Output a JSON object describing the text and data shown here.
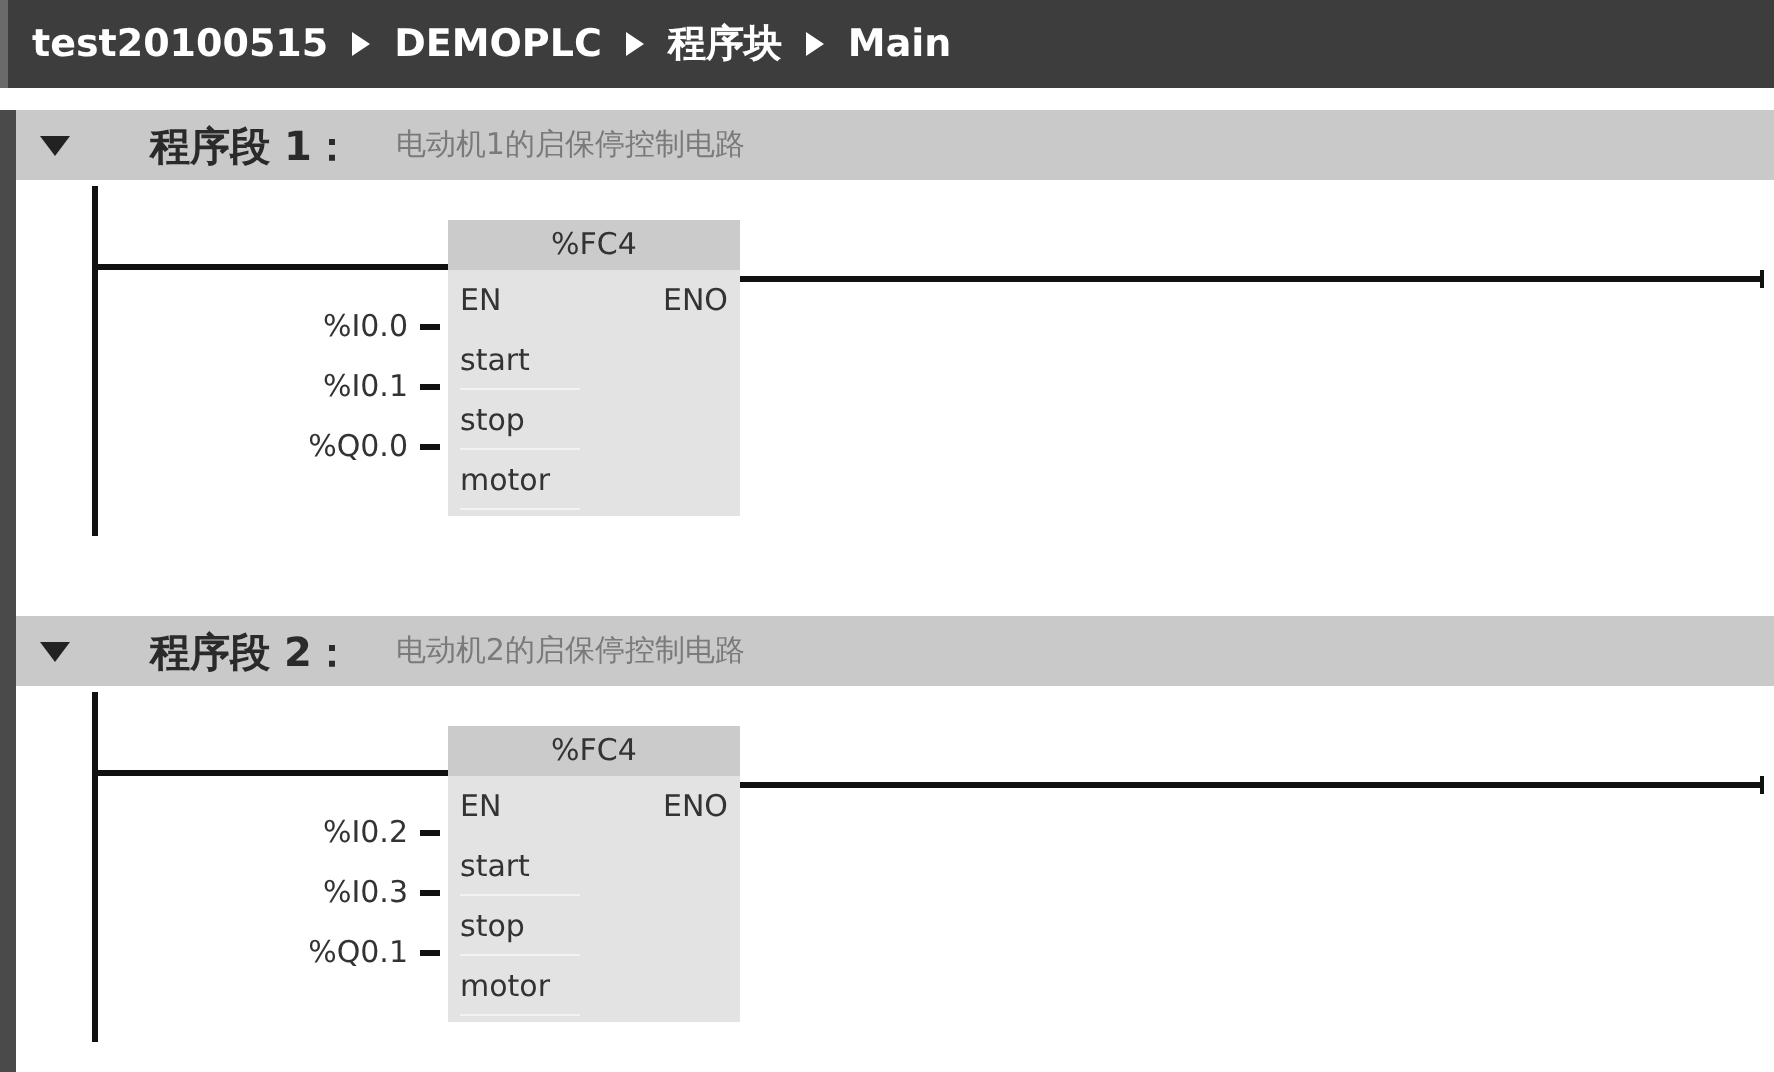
{
  "breadcrumb": [
    "test20100515",
    "DEMOPLC",
    "程序块",
    "Main"
  ],
  "networks": [
    {
      "expanded": true,
      "title": "程序段 1：",
      "comment": "电动机1的启保停控制电路",
      "block": {
        "name": "%FC4",
        "en": "EN",
        "eno": "ENO",
        "params": [
          {
            "operand": "%I0.0",
            "pin": "start"
          },
          {
            "operand": "%I0.1",
            "pin": "stop"
          },
          {
            "operand": "%Q0.0",
            "pin": "motor"
          }
        ]
      }
    },
    {
      "expanded": true,
      "title": "程序段 2：",
      "comment": "电动机2的启保停控制电路",
      "block": {
        "name": "%FC4",
        "en": "EN",
        "eno": "ENO",
        "params": [
          {
            "operand": "%I0.2",
            "pin": "start"
          },
          {
            "operand": "%I0.3",
            "pin": "stop"
          },
          {
            "operand": "%Q0.1",
            "pin": "motor"
          }
        ]
      }
    }
  ]
}
